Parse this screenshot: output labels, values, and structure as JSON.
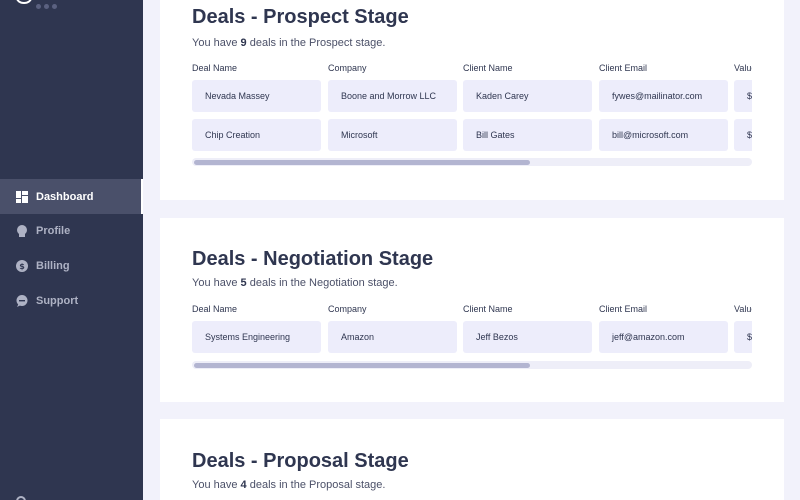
{
  "sidebar": {
    "items": [
      {
        "label": "Dashboard",
        "icon": "dashboard-icon",
        "active": true
      },
      {
        "label": "Profile",
        "icon": "user-icon",
        "active": false
      },
      {
        "label": "Billing",
        "icon": "dollar-icon",
        "active": false
      },
      {
        "label": "Support",
        "icon": "chat-icon",
        "active": false
      }
    ]
  },
  "columns": [
    "Deal Name",
    "Company",
    "Client Name",
    "Client Email",
    "Value"
  ],
  "prospect": {
    "title": "Deals - Prospect Stage",
    "sub_prefix": "You have ",
    "count": "9",
    "sub_suffix": " deals in the Prospect stage.",
    "rows": [
      [
        "Nevada Massey",
        "Boone and Morrow LLC",
        "Kaden Carey",
        "fywes@mailinator.com",
        "$"
      ],
      [
        "Chip Creation",
        "Microsoft",
        "Bill Gates",
        "bill@microsoft.com",
        "$"
      ]
    ]
  },
  "negotiation": {
    "title": "Deals - Negotiation Stage",
    "sub_prefix": "You have ",
    "count": "5",
    "sub_suffix": " deals in the Negotiation stage.",
    "rows": [
      [
        "Systems Engineering",
        "Amazon",
        "Jeff Bezos",
        "jeff@amazon.com",
        "$"
      ]
    ]
  },
  "proposal": {
    "title": "Deals - Proposal Stage",
    "sub_prefix": "You have ",
    "count": "4",
    "sub_suffix": " deals in the Proposal stage."
  },
  "colors": {
    "sidebar": "#2f3650",
    "active": "#4a506a",
    "cell": "#ededfb",
    "background": "#f2f2fb"
  }
}
